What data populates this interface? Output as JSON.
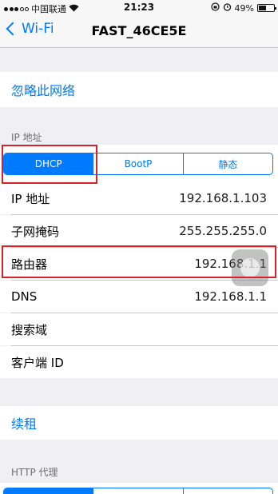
{
  "status_bar": {
    "carrier": "中国联通",
    "time": "21:23",
    "battery_text": "49%",
    "battery_level": 0.49,
    "icons": [
      "signal-dots-icon",
      "wifi-icon",
      "lock-rotation-icon",
      "alarm-icon"
    ]
  },
  "nav": {
    "back_label": "Wi-Fi",
    "title": "FAST_46CE5E"
  },
  "forget_network": "忽略此网络",
  "ip_section_header": "IP 地址",
  "segments": [
    {
      "label": "DHCP",
      "selected": true
    },
    {
      "label": "BootP",
      "selected": false
    },
    {
      "label": "静态",
      "selected": false
    }
  ],
  "details": [
    {
      "label": "IP 地址",
      "value": "192.168.1.103"
    },
    {
      "label": "子网掩码",
      "value": "255.255.255.0"
    },
    {
      "label": "路由器",
      "value": "192.168.1.1"
    },
    {
      "label": "DNS",
      "value": "192.168.1.1"
    },
    {
      "label": "搜索域",
      "value": ""
    },
    {
      "label": "客户端 ID",
      "value": ""
    }
  ],
  "renew_lease": "续租",
  "http_proxy_header": "HTTP 代理",
  "colors": {
    "accent": "#007aff",
    "annotation": "#d8222a",
    "background": "#efeff4"
  }
}
